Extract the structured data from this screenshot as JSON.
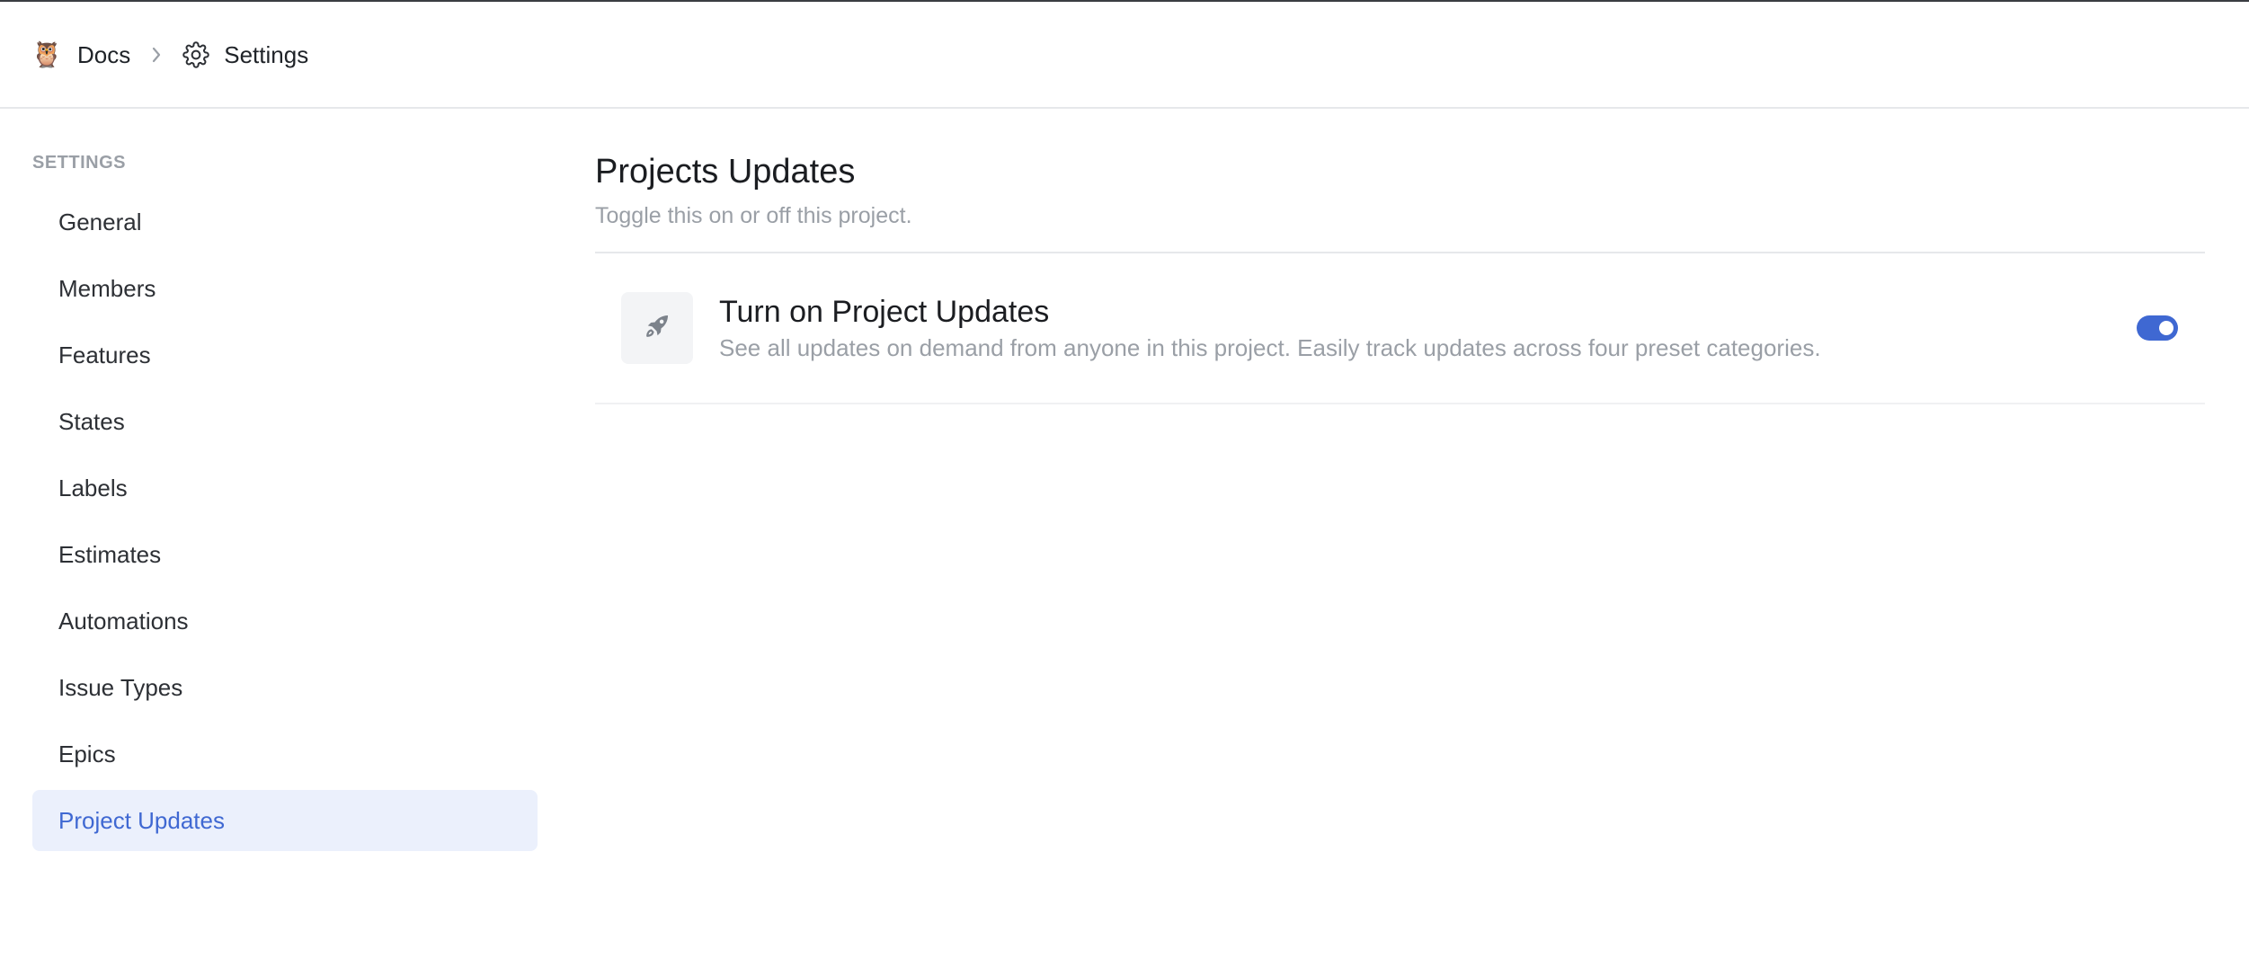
{
  "header": {
    "breadcrumb": {
      "project_emoji": "🦉",
      "project_label": "Docs",
      "separator_icon": "chevron-right-icon",
      "page_icon": "gear-icon",
      "page_label": "Settings"
    }
  },
  "sidebar": {
    "heading": "SETTINGS",
    "items": [
      {
        "label": "General"
      },
      {
        "label": "Members"
      },
      {
        "label": "Features"
      },
      {
        "label": "States"
      },
      {
        "label": "Labels"
      },
      {
        "label": "Estimates"
      },
      {
        "label": "Automations"
      },
      {
        "label": "Issue Types"
      },
      {
        "label": "Epics"
      },
      {
        "label": "Project Updates",
        "active": true
      }
    ]
  },
  "main": {
    "title": "Projects Updates",
    "subtitle": "Toggle this on or off this project.",
    "feature": {
      "icon": "rocket-icon",
      "title": "Turn on Project Updates",
      "description": "See all updates on demand from anyone in this project. Easily track updates across four preset categories.",
      "enabled": true
    }
  },
  "colors": {
    "accent": "#3f68d2",
    "active_bg": "#ebf0fc",
    "muted_text": "#9a9fa6"
  }
}
